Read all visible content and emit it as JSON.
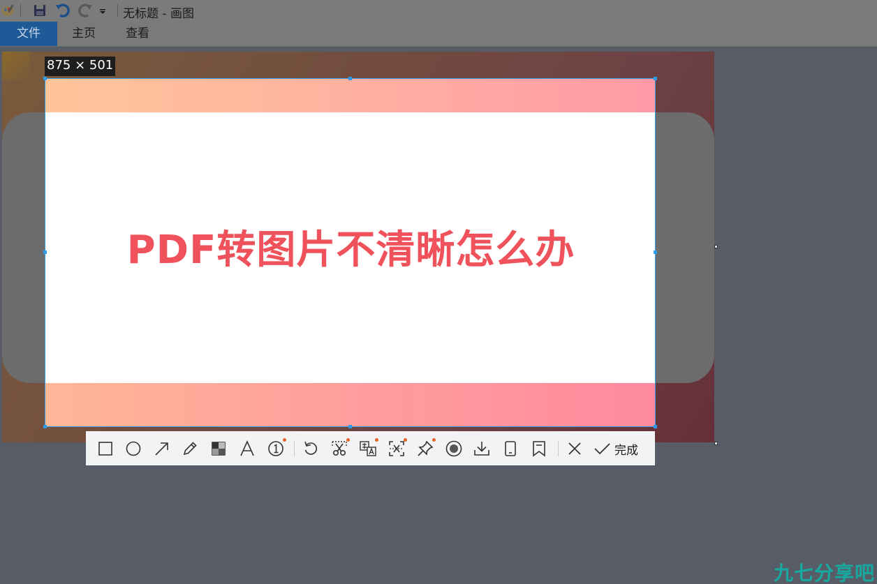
{
  "window": {
    "title": "无标题 - 画图"
  },
  "menu": {
    "tabs": [
      "文件",
      "主页",
      "查看"
    ]
  },
  "selection": {
    "size_label": "875 × 501",
    "headline": "PDF转图片不清晰怎么办"
  },
  "toolbar": {
    "tools": [
      {
        "name": "rectangle-tool",
        "icon": "rectangle-icon"
      },
      {
        "name": "ellipse-tool",
        "icon": "ellipse-icon"
      },
      {
        "name": "arrow-tool",
        "icon": "arrow-icon"
      },
      {
        "name": "pen-tool",
        "icon": "pencil-icon"
      },
      {
        "name": "mosaic-tool",
        "icon": "mosaic-icon"
      },
      {
        "name": "text-tool",
        "icon": "text-icon"
      },
      {
        "name": "number-tool",
        "icon": "number-icon"
      },
      {
        "name": "undo-tool",
        "icon": "undo-icon"
      },
      {
        "name": "cutout-tool",
        "icon": "scissors-icon"
      },
      {
        "name": "translate-tool",
        "icon": "translate-icon"
      },
      {
        "name": "ocr-tool",
        "icon": "ocr-icon"
      },
      {
        "name": "pin-tool",
        "icon": "pin-icon"
      },
      {
        "name": "record-tool",
        "icon": "record-icon"
      },
      {
        "name": "download-tool",
        "icon": "download-icon"
      },
      {
        "name": "phone-tool",
        "icon": "phone-icon"
      },
      {
        "name": "bookmark-tool",
        "icon": "bookmark-icon"
      },
      {
        "name": "close-tool",
        "icon": "close-icon"
      }
    ],
    "done_label": "完成"
  },
  "watermark": "九七分享吧",
  "colors": {
    "selection_border": "#2f9be8",
    "headline": "#f0525c",
    "file_tab": "#1e5a97",
    "new_badge": "#e8622c"
  }
}
